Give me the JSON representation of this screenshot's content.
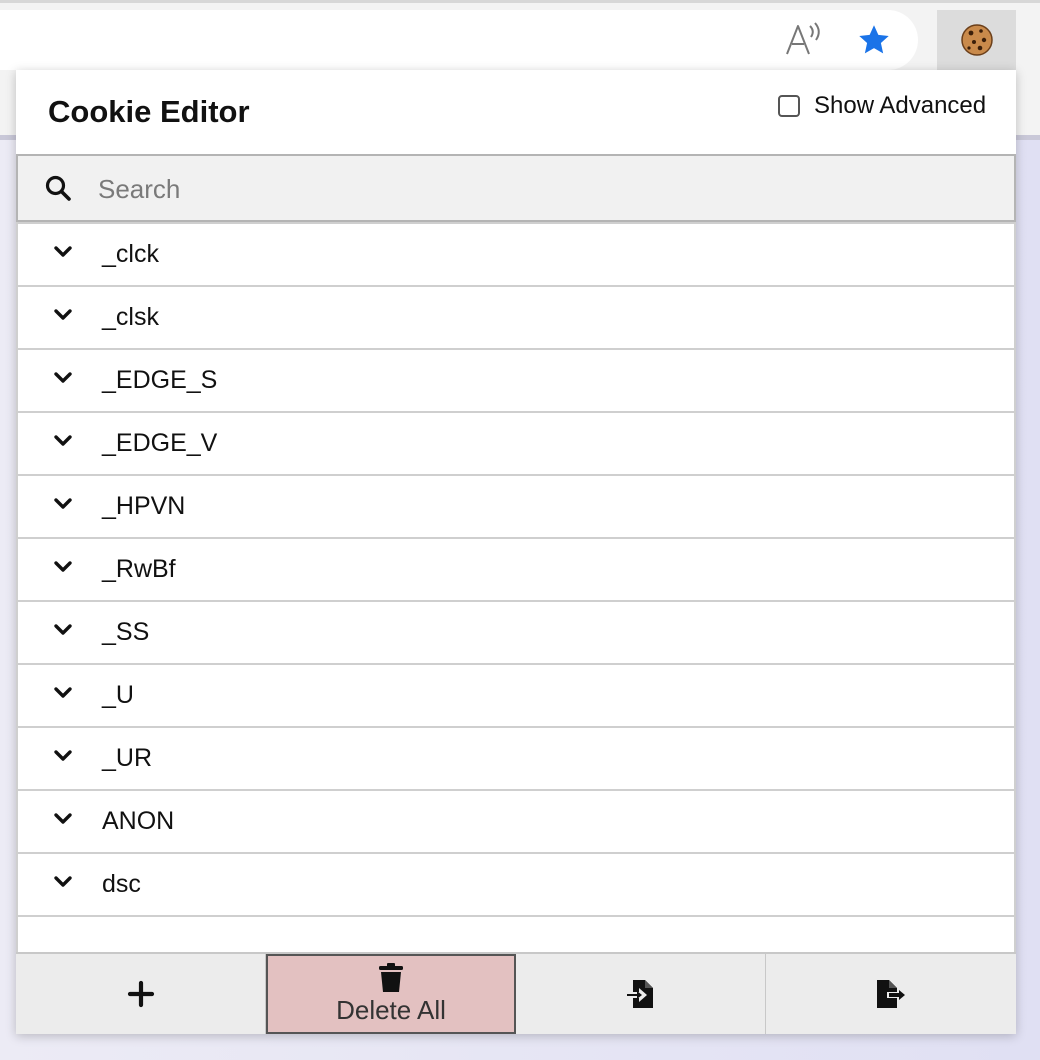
{
  "browser": {
    "toolbar_icons": [
      "read-aloud-icon",
      "favorite-star-icon",
      "cookie-extension-icon"
    ],
    "star_color": "#1a73e8"
  },
  "popup": {
    "title": "Cookie Editor",
    "show_advanced_label": "Show Advanced",
    "show_advanced_checked": false,
    "search": {
      "placeholder": "Search",
      "value": ""
    },
    "cookies": [
      {
        "name": "_clck"
      },
      {
        "name": "_clsk"
      },
      {
        "name": "_EDGE_S"
      },
      {
        "name": "_EDGE_V"
      },
      {
        "name": "_HPVN"
      },
      {
        "name": "_RwBf"
      },
      {
        "name": "_SS"
      },
      {
        "name": "_U"
      },
      {
        "name": "_UR"
      },
      {
        "name": "ANON"
      },
      {
        "name": "dsc"
      },
      {
        "name": ""
      }
    ],
    "footer": {
      "add_icon": "plus-icon",
      "delete_all_label": "Delete All",
      "delete_icon": "trash-icon",
      "import_icon": "import-file-icon",
      "export_icon": "export-file-icon",
      "delete_bg_color": "#e3c1c1"
    }
  }
}
